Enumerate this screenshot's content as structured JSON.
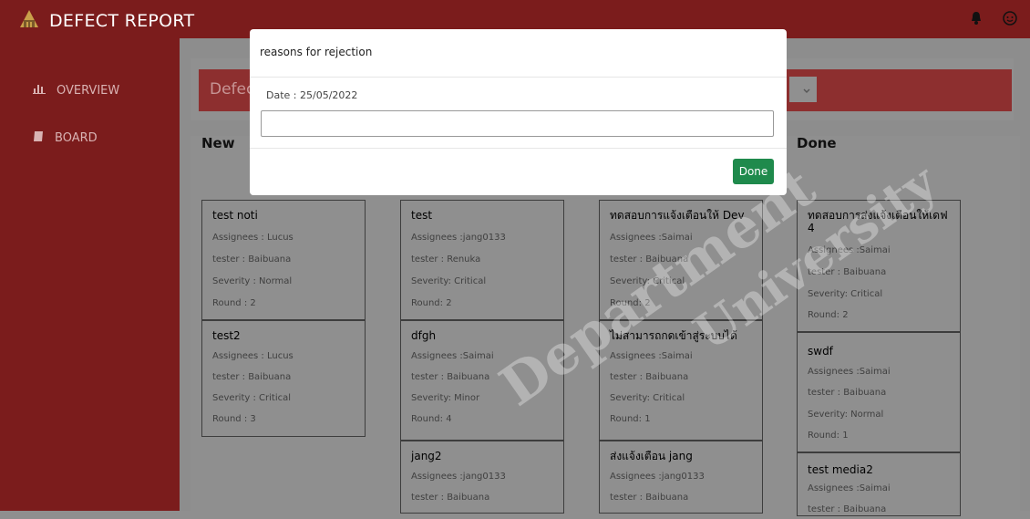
{
  "app": {
    "title": "DEFECT REPORT",
    "logo_icon": "building-logo-icon",
    "bell_icon": "bell-icon",
    "profile_icon": "face-icon"
  },
  "sidebar": {
    "items": [
      {
        "label": "OVERVIEW",
        "icon": "bar-chart-icon"
      },
      {
        "label": "BOARD",
        "icon": "book-icon"
      }
    ]
  },
  "banner": {
    "label": "Defect"
  },
  "modal": {
    "title": "reasons for rejection",
    "date": "Date : 25/05/2022",
    "input_value": "",
    "done_label": "Done"
  },
  "columns": {
    "new": "New",
    "done": "Done"
  },
  "cards": {
    "c1": {
      "name": "test noti",
      "assignees": "Assignees : Lucus",
      "tester": "tester : Baibuana",
      "severity": "Severity : Normal",
      "round": "Round : 2"
    },
    "c2": {
      "name": "test2",
      "assignees": "Assignees : Lucus",
      "tester": "tester : Baibuana",
      "severity": "Severity : Critical",
      "round": "Round : 3"
    },
    "c3": {
      "name": "test",
      "assignees": "Assignees :jang0133",
      "tester": "tester : Renuka",
      "severity": "Severity: Critical",
      "round": "Round: 2"
    },
    "c4": {
      "name": "dfgh",
      "assignees": "Assignees :Saimai",
      "tester": "tester : Baibuana",
      "severity": "Severity: Minor",
      "round": "Round: 4"
    },
    "c5": {
      "name": "jang2",
      "assignees": "Assignees :jang0133",
      "tester": "tester : Baibuana"
    },
    "c6": {
      "name": "ทดสอบการแจ้งเตือนให้ Dev",
      "assignees": "Assignees :Saimai",
      "tester": "tester : Baibuana",
      "severity": "Severity: Critical",
      "round": "Round: 2"
    },
    "c7": {
      "name": "ไม่สามารถกดเข้าสู่ระบบได้",
      "assignees": "Assignees :Saimai",
      "tester": "tester : Baibuana",
      "severity": "Severity: Critical",
      "round": "Round: 1"
    },
    "c8": {
      "name": "ส่งแจ้งเตือน jang",
      "assignees": "Assignees :jang0133",
      "tester": "tester : Baibuana"
    },
    "c9": {
      "name": "ทดสอบการส่งแจ้งเตือนให้เดฟ 4",
      "assignees": "Assignees :Saimai",
      "tester": "tester : Baibuana",
      "severity": "Severity: Critical",
      "round": "Round: 2"
    },
    "c10": {
      "name": "swdf",
      "assignees": "Assignees :Saimai",
      "tester": "tester : Baibuana",
      "severity": "Severity: Normal",
      "round": "Round: 1"
    },
    "c11": {
      "name": "test media2",
      "assignees": "Assignees :Saimai",
      "tester": "tester : Baibuana"
    }
  },
  "watermark": {
    "line1": "Department",
    "line2": "University"
  }
}
